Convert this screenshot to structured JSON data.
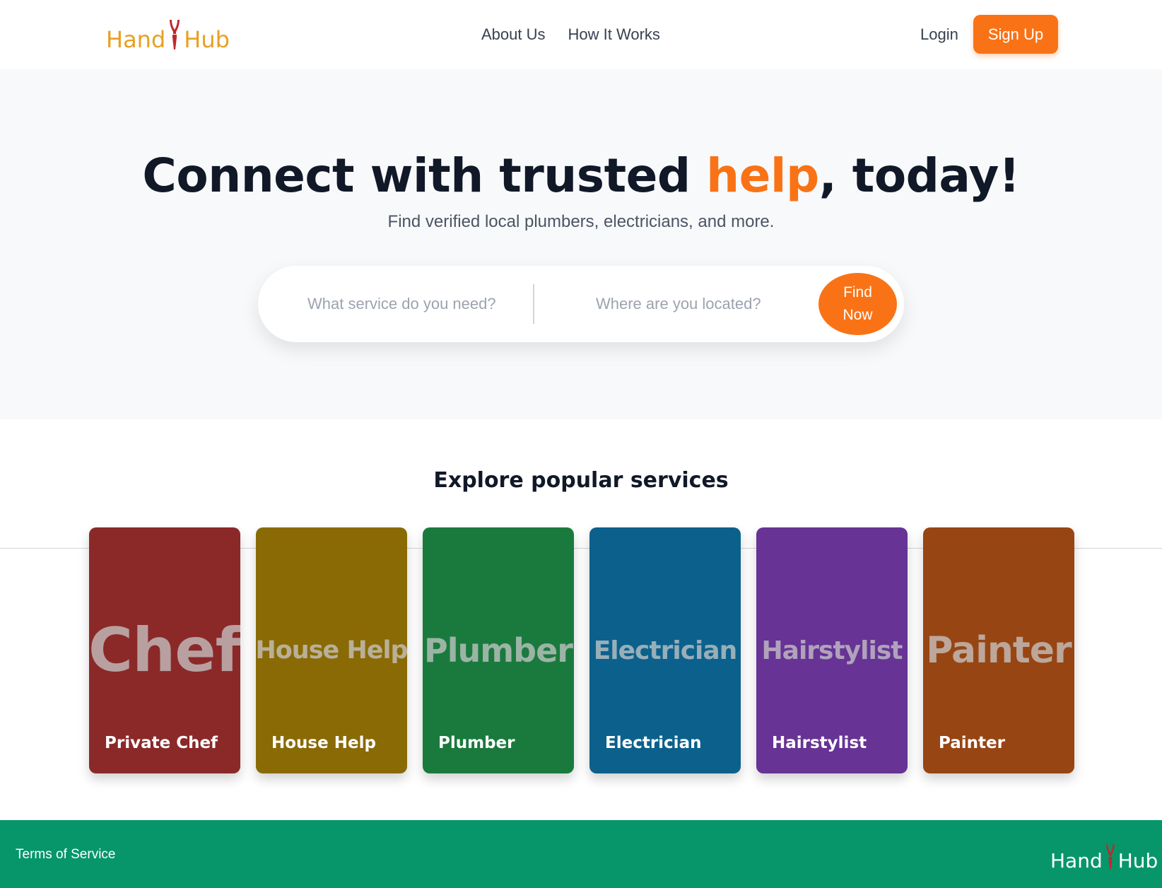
{
  "header": {
    "logo": {
      "left_text": "Hand",
      "right_text": "Hub",
      "icon": "pliers-icon"
    },
    "nav": [
      {
        "label": "About Us"
      },
      {
        "label": "How It Works"
      }
    ],
    "login_label": "Login",
    "signup_label": "Sign Up"
  },
  "hero": {
    "title_before": "Connect with trusted ",
    "title_accent": "help",
    "title_after": ", today!",
    "subtitle": "Find verified local plumbers, electricians, and more.",
    "search": {
      "service_placeholder": "What service do you need?",
      "location_placeholder": "Where are you located?",
      "button_line1": "Find",
      "button_line2": "Now"
    }
  },
  "services": {
    "title": "Explore popular services",
    "cards": [
      {
        "bg_text": "Chef",
        "label": "Private Chef",
        "color": "#8b2929"
      },
      {
        "bg_text": "House Help",
        "label": "House Help",
        "color": "#8a6a05"
      },
      {
        "bg_text": "Plumber",
        "label": "Plumber",
        "color": "#1a7a3d"
      },
      {
        "bg_text": "Electrician",
        "label": "Electrician",
        "color": "#0b618c"
      },
      {
        "bg_text": "Hairstylist",
        "label": "Hairstylist",
        "color": "#673395"
      },
      {
        "bg_text": "Painter",
        "label": "Painter",
        "color": "#974513"
      }
    ]
  },
  "footer": {
    "terms_label": "Terms of Service",
    "logo": {
      "left_text": "Hand",
      "right_text": "Hub",
      "icon": "pliers-icon"
    }
  },
  "colors": {
    "accent": "#f97316",
    "logo_gold": "#e8a021",
    "logo_pliers": "#c0282d",
    "footer_green": "#079669",
    "hero_bg": "#f8f9fb"
  }
}
